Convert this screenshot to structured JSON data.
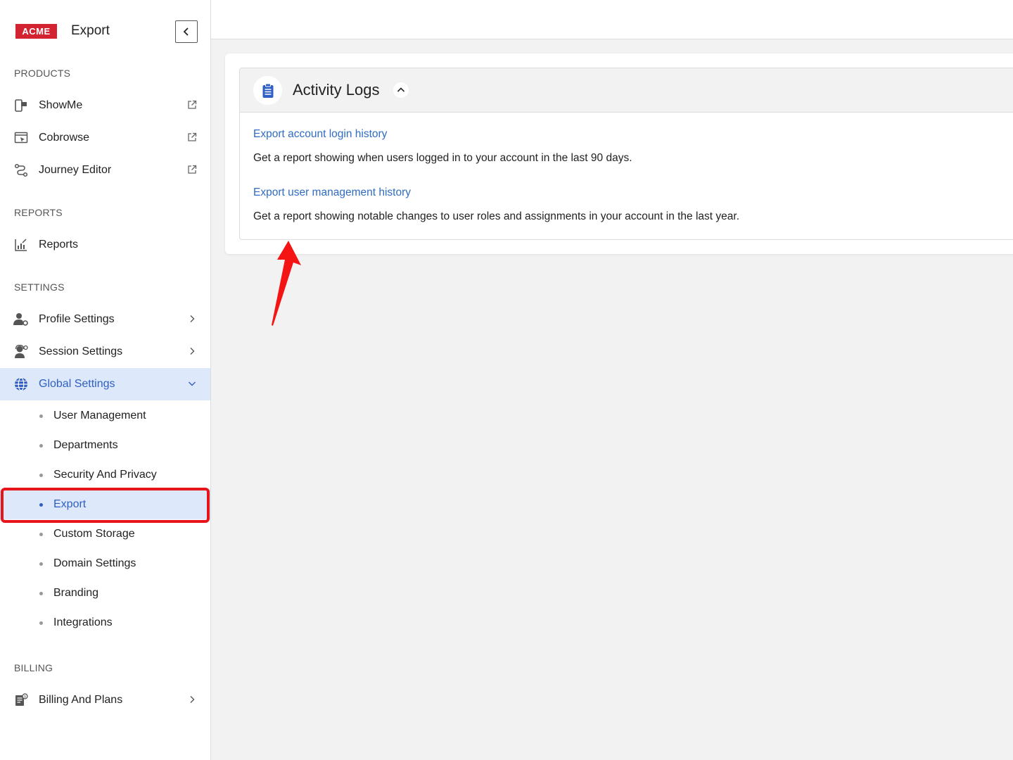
{
  "header": {
    "logo_text": "ACME",
    "title": "Export"
  },
  "sidebar": {
    "sections": {
      "products": "PRODUCTS",
      "reports": "REPORTS",
      "settings": "SETTINGS",
      "billing": "BILLING"
    },
    "products": [
      {
        "label": "ShowMe",
        "icon": "showme-icon",
        "trail": "external-link-icon"
      },
      {
        "label": "Cobrowse",
        "icon": "cobrowse-icon",
        "trail": "external-link-icon"
      },
      {
        "label": "Journey Editor",
        "icon": "journey-icon",
        "trail": "external-link-icon"
      }
    ],
    "reports": [
      {
        "label": "Reports",
        "icon": "reports-icon"
      }
    ],
    "settings": [
      {
        "label": "Profile Settings",
        "icon": "profile-settings-icon",
        "trail": "chevron-right-icon"
      },
      {
        "label": "Session Settings",
        "icon": "session-settings-icon",
        "trail": "chevron-right-icon"
      },
      {
        "label": "Global Settings",
        "icon": "globe-icon",
        "trail": "chevron-down-icon",
        "active": true
      }
    ],
    "global_sub": [
      {
        "label": "User Management"
      },
      {
        "label": "Departments"
      },
      {
        "label": "Security And Privacy"
      },
      {
        "label": "Export",
        "active": true
      },
      {
        "label": "Custom Storage"
      },
      {
        "label": "Domain Settings"
      },
      {
        "label": "Branding"
      },
      {
        "label": "Integrations"
      }
    ],
    "billing": [
      {
        "label": "Billing And Plans",
        "icon": "billing-icon",
        "trail": "chevron-right-icon"
      }
    ]
  },
  "main": {
    "panel": {
      "title": "Activity Logs",
      "icon": "clipboard-icon",
      "items": [
        {
          "link": "Export account login history",
          "description": "Get a report showing when users logged in to your account in the last 90 days."
        },
        {
          "link": "Export user management history",
          "description": "Get a report showing notable changes to user roles and assignments in your account in the last year."
        }
      ]
    }
  },
  "colors": {
    "accent": "#2f5fc4",
    "active_bg": "#dde8fb",
    "brand_red": "#d42330",
    "annotation_red": "#e8141b"
  }
}
